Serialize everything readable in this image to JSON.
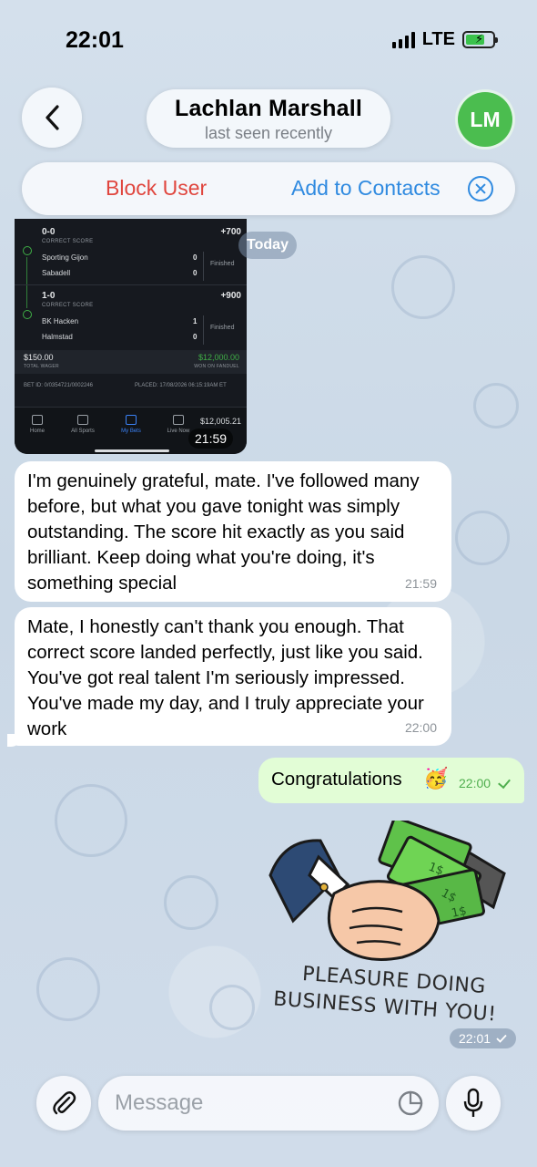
{
  "status_bar": {
    "time": "22:01",
    "network": "LTE"
  },
  "header": {
    "contact_name": "Lachlan Marshall",
    "contact_status": "last seen recently",
    "avatar_initials": "LM",
    "avatar_color": "#4bbd4f"
  },
  "action_bar": {
    "block_label": "Block User",
    "add_label": "Add to Contacts"
  },
  "date_chip": "Today",
  "bet_slip": {
    "selections": [
      {
        "score": "0-0",
        "type": "CORRECT SCORE",
        "odds": "+700",
        "home_team": "Sporting Gijon",
        "away_team": "Sabadell",
        "home_goals": "0",
        "away_goals": "0",
        "status": "Finished"
      },
      {
        "score": "1-0",
        "type": "CORRECT SCORE",
        "odds": "+900",
        "home_team": "BK Hacken",
        "away_team": "Halmstad",
        "home_goals": "1",
        "away_goals": "0",
        "status": "Finished"
      }
    ],
    "total_wager": "$150.00",
    "total_wager_label": "TOTAL WAGER",
    "won_amount": "$12,000.00",
    "won_label": "WON ON FANDUEL",
    "bet_id": "BET ID: 0/0354721/0002246",
    "placed": "PLACED: 17/08/2026 06:15:19AM ET",
    "tabs": [
      "Home",
      "All Sports",
      "My Bets",
      "Live Now"
    ],
    "active_tab": "My Bets",
    "balance": "$12,005.21",
    "time": "21:59"
  },
  "messages": [
    {
      "text": "I'm genuinely grateful, mate. I've followed many before, but what you gave tonight was simply outstanding. The score hit exactly as you said brilliant. Keep doing what you're doing, it's something special",
      "time": "21:59"
    },
    {
      "text": "Mate, I honestly can't thank you enough. That correct score landed perfectly, just like you said. You've got real talent I'm seriously impressed. You've made my day, and I truly appreciate your work",
      "time": "22:00"
    },
    {
      "text": "Congratulations",
      "emoji": "🥳",
      "time": "22:00"
    }
  ],
  "sticker": {
    "caption_line1": "PLEASURE DOING",
    "caption_line2": "BUSINESS WITH YOU!",
    "bill_label": "1$",
    "time": "22:01"
  },
  "composer": {
    "placeholder": "Message"
  }
}
